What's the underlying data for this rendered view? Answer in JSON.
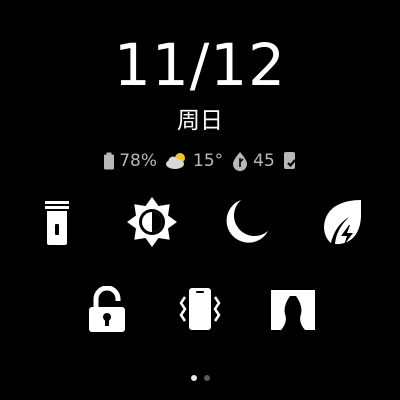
{
  "header": {
    "date": "11/12",
    "weekday": "周日"
  },
  "status": {
    "battery": {
      "icon": "battery-icon",
      "value": "78%"
    },
    "weather": {
      "icon": "partly-cloudy-icon",
      "value": "15°"
    },
    "air_quality": {
      "icon": "leaf-drop-icon",
      "value": "45"
    },
    "phone": {
      "icon": "phone-connected-icon"
    }
  },
  "quick_settings": {
    "row1": [
      {
        "icon": "flashlight-icon"
      },
      {
        "icon": "brightness-icon"
      },
      {
        "icon": "do-not-disturb-moon-icon"
      },
      {
        "icon": "power-saving-leaf-icon"
      }
    ],
    "row2": [
      {
        "icon": "lock-icon"
      },
      {
        "icon": "find-phone-vibrate-icon"
      },
      {
        "icon": "theater-mode-icon"
      }
    ]
  },
  "pager": {
    "pages": 2,
    "current": 1
  },
  "colors": {
    "background": "#000000",
    "foreground": "#ffffff",
    "secondary_text": "#b8b8b8"
  }
}
